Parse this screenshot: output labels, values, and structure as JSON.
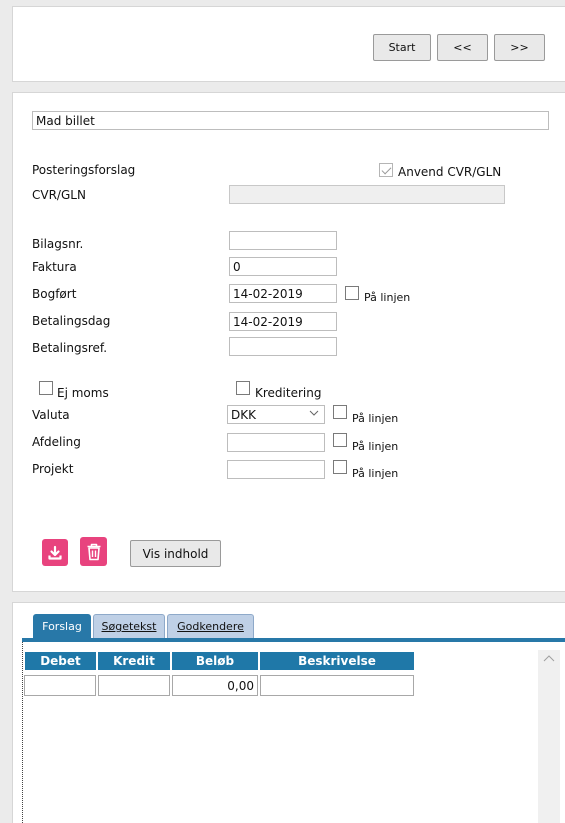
{
  "nav": {
    "start_label": "Start",
    "prev_label": "<<",
    "next_label": ">>"
  },
  "form": {
    "description_value": "Mad billet",
    "posteringsforslag_label": "Posteringsforslag",
    "anvend_cvr_label": "Anvend CVR/GLN",
    "anvend_cvr_checked": true,
    "cvr_label": "CVR/GLN",
    "cvr_value": "",
    "bilagsnr_label": "Bilagsnr.",
    "bilagsnr_value": "",
    "faktura_label": "Faktura",
    "faktura_value": "0",
    "bogfoert_label": "Bogført",
    "bogfoert_value": "14-02-2019",
    "paa_linjen_label": "På linjen",
    "betalingsdag_label": "Betalingsdag",
    "betalingsdag_value": "14-02-2019",
    "betalingsref_label": "Betalingsref.",
    "betalingsref_value": "",
    "ej_moms_label": "Ej moms",
    "kreditering_label": "Kreditering",
    "valuta_label": "Valuta",
    "valuta_value": "DKK",
    "afdeling_label": "Afdeling",
    "afdeling_value": "",
    "projekt_label": "Projekt",
    "projekt_value": "",
    "vis_indhold_label": "Vis indhold"
  },
  "tabs": [
    {
      "label": "Forslag",
      "active": true
    },
    {
      "label": "Søgetekst",
      "active": false
    },
    {
      "label": "Godkendere",
      "active": false
    }
  ],
  "grid": {
    "columns": [
      "Debet",
      "Kredit",
      "Beløb",
      "Beskrivelse"
    ],
    "rows": [
      {
        "debet": "",
        "kredit": "",
        "beloeb": "0,00",
        "beskrivelse": ""
      }
    ]
  },
  "colors": {
    "accent_pink": "#e8437e",
    "tab_blue": "#2878a8",
    "tab_inactive": "#bfd0e6"
  }
}
